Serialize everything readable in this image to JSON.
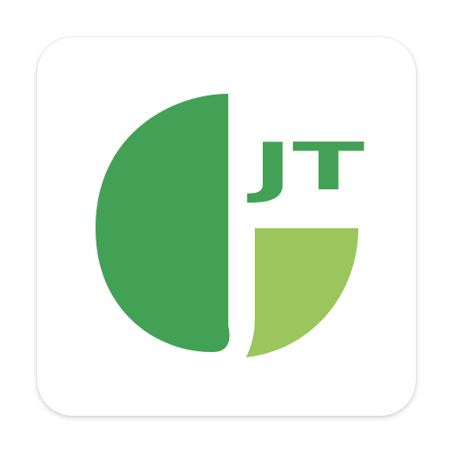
{
  "app_icon": {
    "logo_text": "JT",
    "colors": {
      "background": "#ffffff",
      "dark_green": "#43a155",
      "light_green": "#9ac65b"
    },
    "icon_name": "jt-logo-icon"
  }
}
